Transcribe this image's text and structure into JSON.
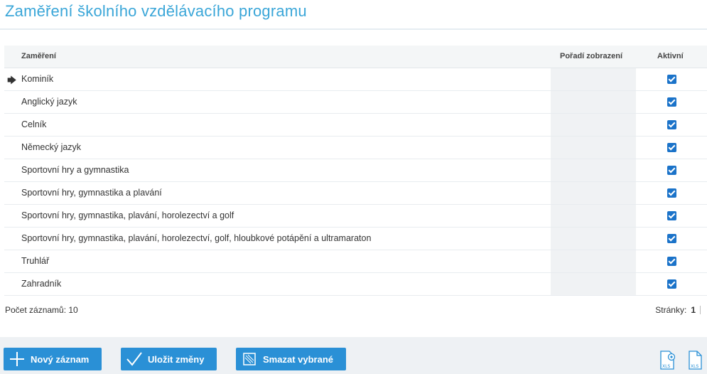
{
  "page": {
    "title": "Zaměření školního vzdělávacího programu"
  },
  "grid": {
    "columns": {
      "name": "Zaměření",
      "order": "Pořadí zobrazení",
      "active": "Aktivní"
    },
    "rows": [
      {
        "name": "Kominík",
        "order": "",
        "active": true,
        "current": true
      },
      {
        "name": "Anglický jazyk",
        "order": "",
        "active": true
      },
      {
        "name": "Celník",
        "order": "",
        "active": true
      },
      {
        "name": "Německý jazyk",
        "order": "",
        "active": true
      },
      {
        "name": "Sportovní hry a gymnastika",
        "order": "",
        "active": true
      },
      {
        "name": "Sportovní hry, gymnastika a plavání",
        "order": "",
        "active": true
      },
      {
        "name": "Sportovní hry, gymnastika, plavání, horolezectví a golf",
        "order": "",
        "active": true
      },
      {
        "name": "Sportovní hry, gymnastika, plavání, horolezectví, golf, hloubkové potápění a ultramaraton",
        "order": "",
        "active": true
      },
      {
        "name": "Truhlář",
        "order": "",
        "active": true
      },
      {
        "name": "Zahradník",
        "order": "",
        "active": true
      }
    ],
    "current_row_marker": "🡆"
  },
  "footer": {
    "count_label": "Počet záznamů: 10",
    "pages_label": "Stránky:",
    "page_number": "1"
  },
  "toolbar": {
    "new_label": "Nový záznam",
    "save_label": "Uložit změny",
    "delete_label": "Smazat vybrané",
    "xls_badge": "XLS"
  },
  "colors": {
    "accent": "#2a90d6",
    "title": "#3aa6d8",
    "checkbox": "#1b73c9"
  }
}
